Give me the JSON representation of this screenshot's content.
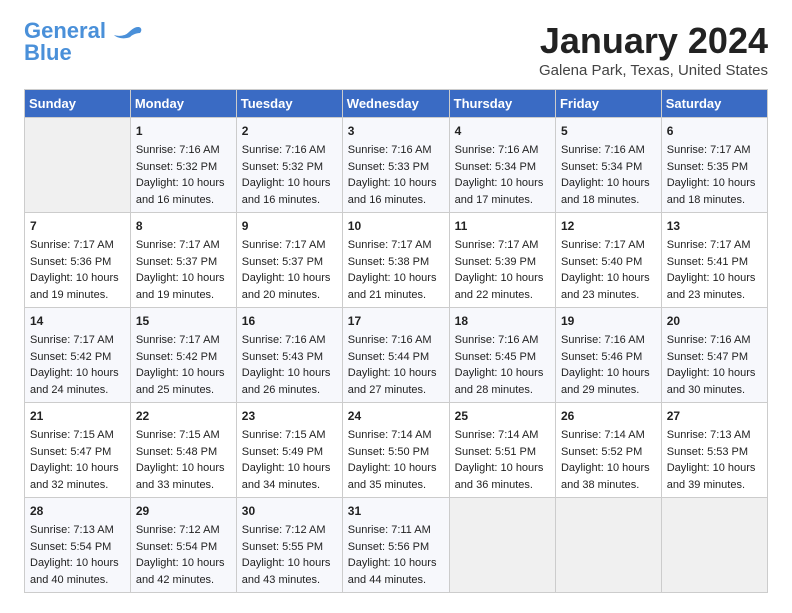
{
  "logo": {
    "line1": "General",
    "line2": "Blue"
  },
  "title": "January 2024",
  "location": "Galena Park, Texas, United States",
  "days_of_week": [
    "Sunday",
    "Monday",
    "Tuesday",
    "Wednesday",
    "Thursday",
    "Friday",
    "Saturday"
  ],
  "weeks": [
    [
      {
        "day": "",
        "data": ""
      },
      {
        "day": "1",
        "data": "Sunrise: 7:16 AM\nSunset: 5:32 PM\nDaylight: 10 hours\nand 16 minutes."
      },
      {
        "day": "2",
        "data": "Sunrise: 7:16 AM\nSunset: 5:32 PM\nDaylight: 10 hours\nand 16 minutes."
      },
      {
        "day": "3",
        "data": "Sunrise: 7:16 AM\nSunset: 5:33 PM\nDaylight: 10 hours\nand 16 minutes."
      },
      {
        "day": "4",
        "data": "Sunrise: 7:16 AM\nSunset: 5:34 PM\nDaylight: 10 hours\nand 17 minutes."
      },
      {
        "day": "5",
        "data": "Sunrise: 7:16 AM\nSunset: 5:34 PM\nDaylight: 10 hours\nand 18 minutes."
      },
      {
        "day": "6",
        "data": "Sunrise: 7:17 AM\nSunset: 5:35 PM\nDaylight: 10 hours\nand 18 minutes."
      }
    ],
    [
      {
        "day": "7",
        "data": "Sunrise: 7:17 AM\nSunset: 5:36 PM\nDaylight: 10 hours\nand 19 minutes."
      },
      {
        "day": "8",
        "data": "Sunrise: 7:17 AM\nSunset: 5:37 PM\nDaylight: 10 hours\nand 19 minutes."
      },
      {
        "day": "9",
        "data": "Sunrise: 7:17 AM\nSunset: 5:37 PM\nDaylight: 10 hours\nand 20 minutes."
      },
      {
        "day": "10",
        "data": "Sunrise: 7:17 AM\nSunset: 5:38 PM\nDaylight: 10 hours\nand 21 minutes."
      },
      {
        "day": "11",
        "data": "Sunrise: 7:17 AM\nSunset: 5:39 PM\nDaylight: 10 hours\nand 22 minutes."
      },
      {
        "day": "12",
        "data": "Sunrise: 7:17 AM\nSunset: 5:40 PM\nDaylight: 10 hours\nand 23 minutes."
      },
      {
        "day": "13",
        "data": "Sunrise: 7:17 AM\nSunset: 5:41 PM\nDaylight: 10 hours\nand 23 minutes."
      }
    ],
    [
      {
        "day": "14",
        "data": "Sunrise: 7:17 AM\nSunset: 5:42 PM\nDaylight: 10 hours\nand 24 minutes."
      },
      {
        "day": "15",
        "data": "Sunrise: 7:17 AM\nSunset: 5:42 PM\nDaylight: 10 hours\nand 25 minutes."
      },
      {
        "day": "16",
        "data": "Sunrise: 7:16 AM\nSunset: 5:43 PM\nDaylight: 10 hours\nand 26 minutes."
      },
      {
        "day": "17",
        "data": "Sunrise: 7:16 AM\nSunset: 5:44 PM\nDaylight: 10 hours\nand 27 minutes."
      },
      {
        "day": "18",
        "data": "Sunrise: 7:16 AM\nSunset: 5:45 PM\nDaylight: 10 hours\nand 28 minutes."
      },
      {
        "day": "19",
        "data": "Sunrise: 7:16 AM\nSunset: 5:46 PM\nDaylight: 10 hours\nand 29 minutes."
      },
      {
        "day": "20",
        "data": "Sunrise: 7:16 AM\nSunset: 5:47 PM\nDaylight: 10 hours\nand 30 minutes."
      }
    ],
    [
      {
        "day": "21",
        "data": "Sunrise: 7:15 AM\nSunset: 5:47 PM\nDaylight: 10 hours\nand 32 minutes."
      },
      {
        "day": "22",
        "data": "Sunrise: 7:15 AM\nSunset: 5:48 PM\nDaylight: 10 hours\nand 33 minutes."
      },
      {
        "day": "23",
        "data": "Sunrise: 7:15 AM\nSunset: 5:49 PM\nDaylight: 10 hours\nand 34 minutes."
      },
      {
        "day": "24",
        "data": "Sunrise: 7:14 AM\nSunset: 5:50 PM\nDaylight: 10 hours\nand 35 minutes."
      },
      {
        "day": "25",
        "data": "Sunrise: 7:14 AM\nSunset: 5:51 PM\nDaylight: 10 hours\nand 36 minutes."
      },
      {
        "day": "26",
        "data": "Sunrise: 7:14 AM\nSunset: 5:52 PM\nDaylight: 10 hours\nand 38 minutes."
      },
      {
        "day": "27",
        "data": "Sunrise: 7:13 AM\nSunset: 5:53 PM\nDaylight: 10 hours\nand 39 minutes."
      }
    ],
    [
      {
        "day": "28",
        "data": "Sunrise: 7:13 AM\nSunset: 5:54 PM\nDaylight: 10 hours\nand 40 minutes."
      },
      {
        "day": "29",
        "data": "Sunrise: 7:12 AM\nSunset: 5:54 PM\nDaylight: 10 hours\nand 42 minutes."
      },
      {
        "day": "30",
        "data": "Sunrise: 7:12 AM\nSunset: 5:55 PM\nDaylight: 10 hours\nand 43 minutes."
      },
      {
        "day": "31",
        "data": "Sunrise: 7:11 AM\nSunset: 5:56 PM\nDaylight: 10 hours\nand 44 minutes."
      },
      {
        "day": "",
        "data": ""
      },
      {
        "day": "",
        "data": ""
      },
      {
        "day": "",
        "data": ""
      }
    ]
  ]
}
